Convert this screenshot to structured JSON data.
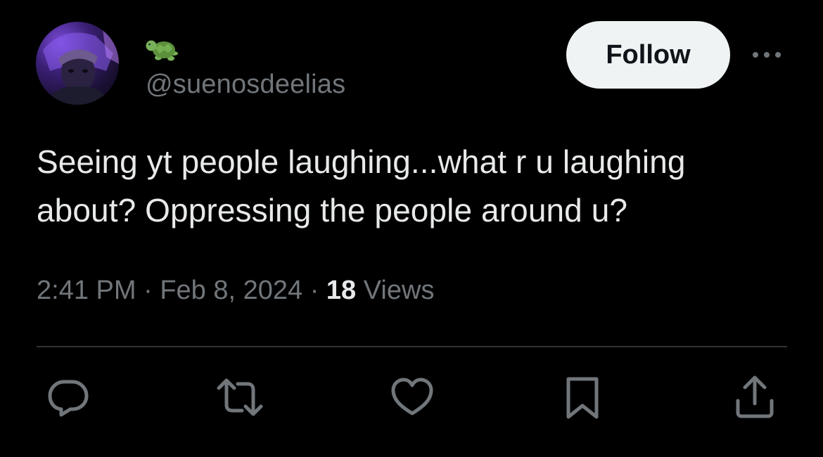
{
  "author": {
    "emoji_icon": "turtle-icon",
    "handle": "@suenosdeelias",
    "avatar_icon": "avatar-photo"
  },
  "header": {
    "follow_label": "Follow",
    "more_icon": "more-horizontal-icon"
  },
  "tweet": {
    "text": "Seeing yt people laughing...what r u laughing about? Oppressing the people around u?"
  },
  "meta": {
    "time": "2:41 PM",
    "separator": "·",
    "date": "Feb 8, 2024",
    "views_count": "18",
    "views_label": "Views"
  },
  "actions": [
    {
      "icon": "reply-icon"
    },
    {
      "icon": "retweet-icon"
    },
    {
      "icon": "like-icon"
    },
    {
      "icon": "bookmark-icon"
    },
    {
      "icon": "share-icon"
    }
  ],
  "colors": {
    "background": "#000000",
    "primary_text": "#e7e9ea",
    "secondary_text": "#71767b",
    "divider": "#2f3336",
    "follow_button_bg": "#eff3f4",
    "follow_button_text": "#0f1419"
  }
}
